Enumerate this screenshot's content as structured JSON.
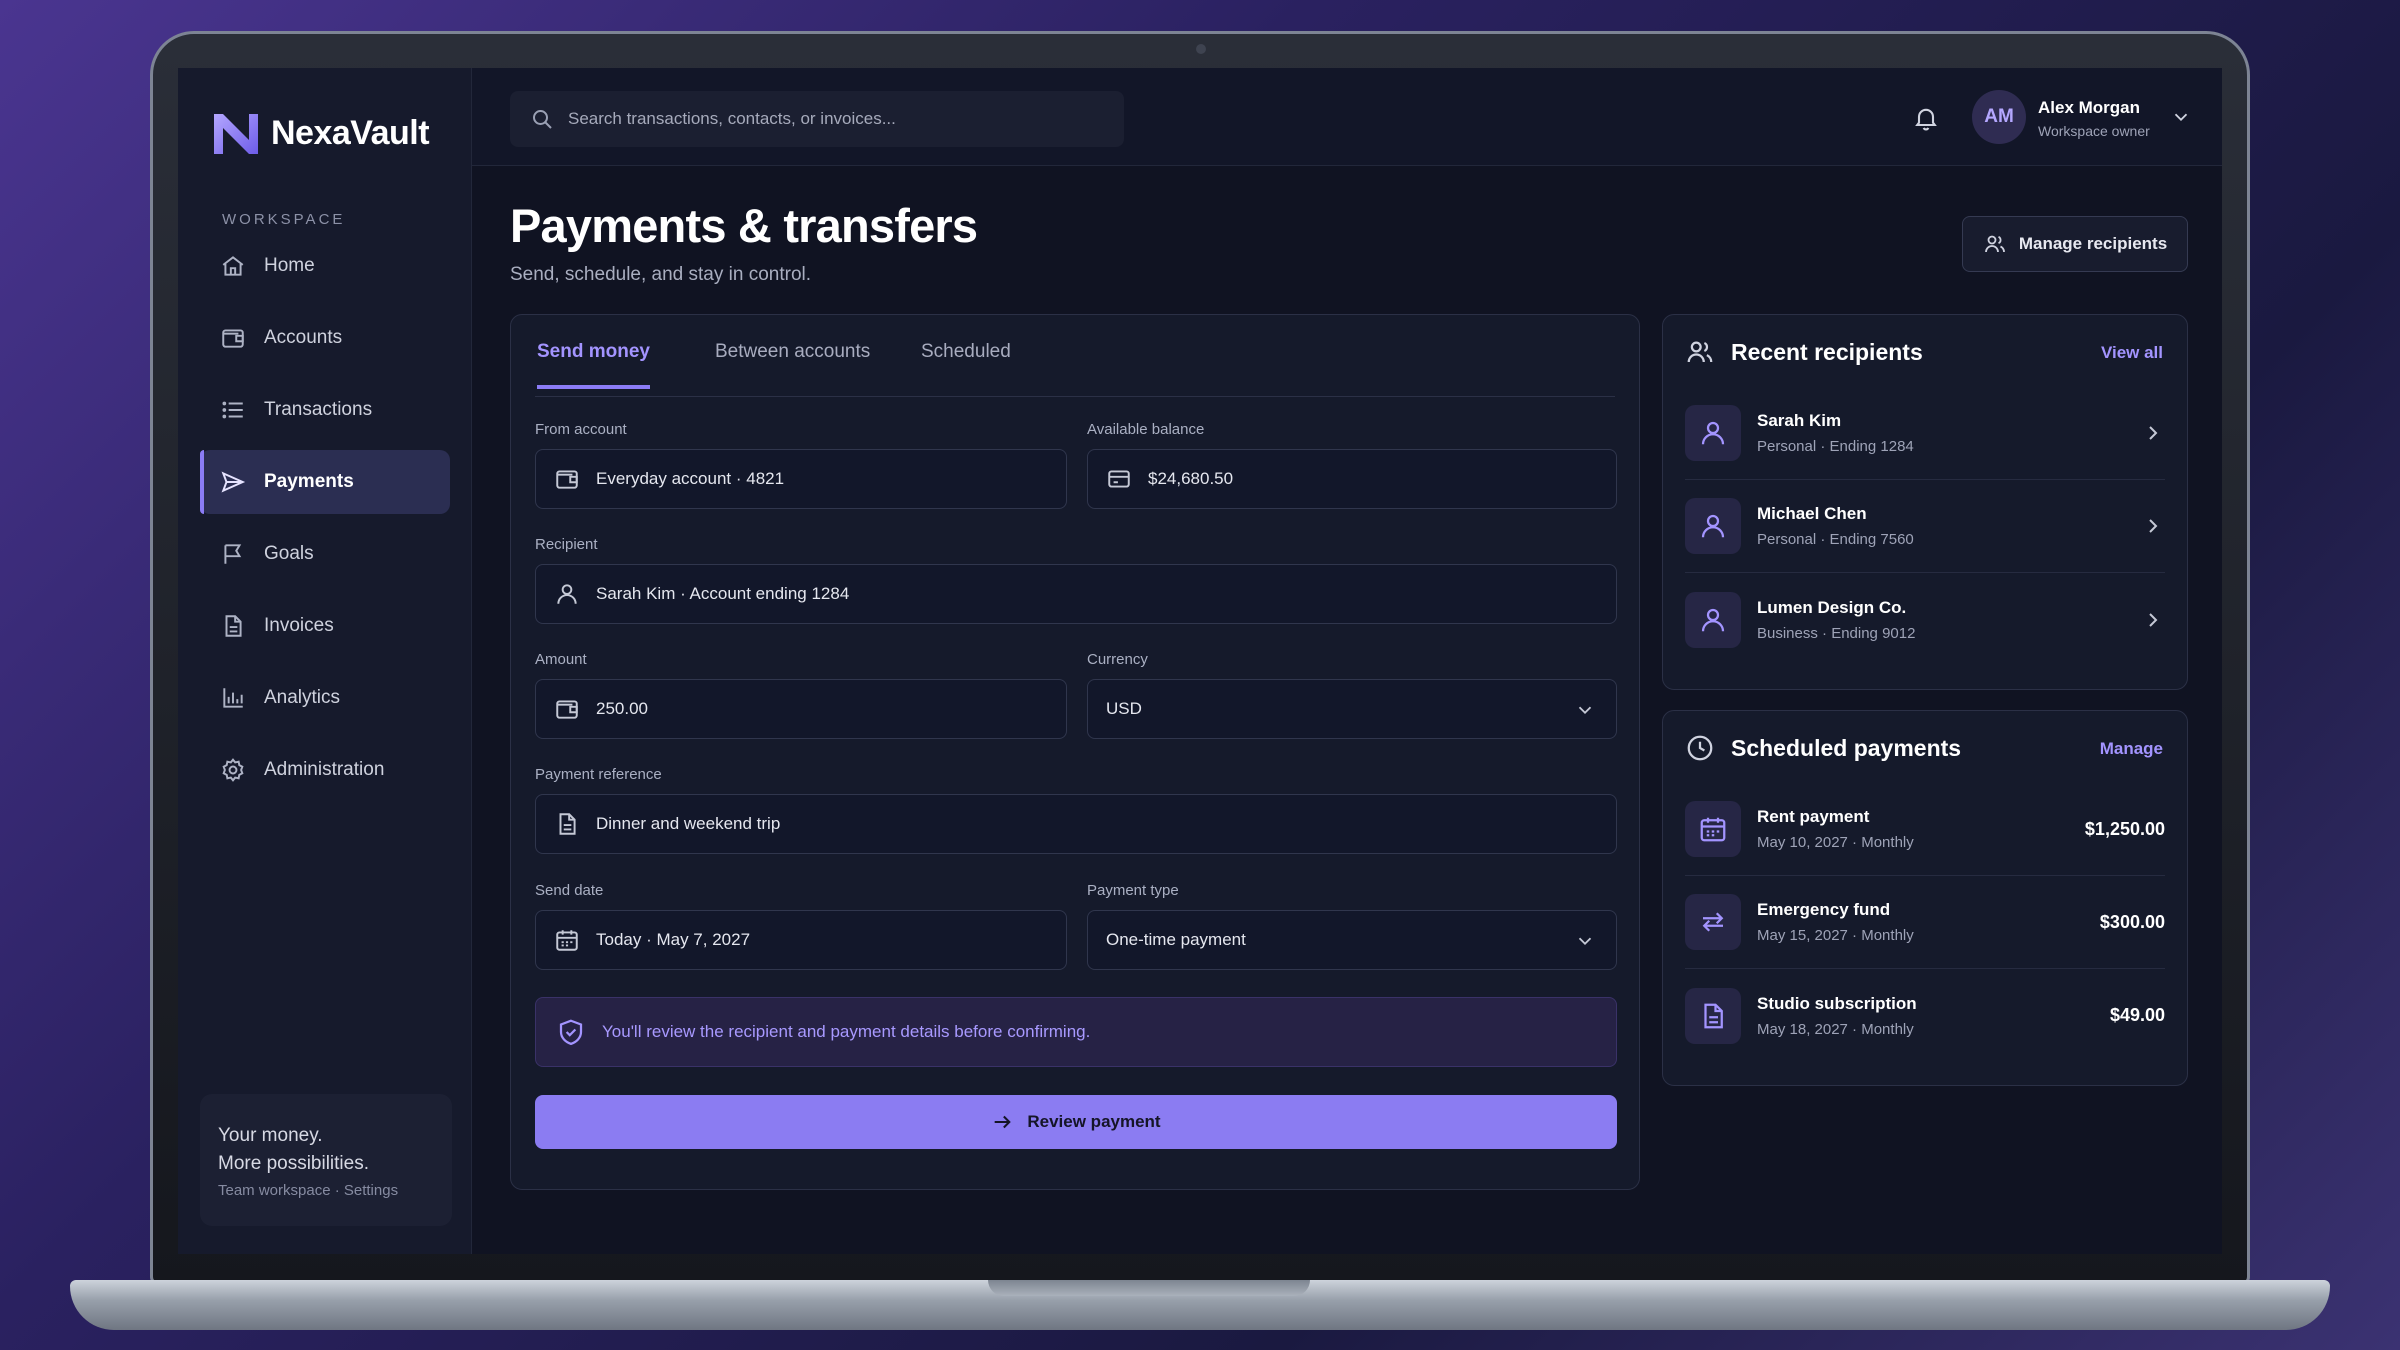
{
  "brand": {
    "name": "NexaVault"
  },
  "sidebar": {
    "section_label": "WORKSPACE",
    "items": [
      {
        "label": "Home",
        "icon": "home-icon"
      },
      {
        "label": "Accounts",
        "icon": "wallet-icon"
      },
      {
        "label": "Transactions",
        "icon": "list-icon"
      },
      {
        "label": "Payments",
        "icon": "send-icon",
        "active": true
      },
      {
        "label": "Goals",
        "icon": "flag-icon"
      },
      {
        "label": "Invoices",
        "icon": "document-icon"
      },
      {
        "label": "Analytics",
        "icon": "bar-chart-icon"
      },
      {
        "label": "Administration",
        "icon": "gear-icon"
      }
    ],
    "promo": {
      "line1": "Your money.",
      "line2": "More possibilities.",
      "sub": "Team workspace · Settings"
    }
  },
  "topbar": {
    "search_placeholder": "Search transactions, contacts, or invoices...",
    "user": {
      "initials": "AM",
      "name": "Alex Morgan",
      "role": "Workspace owner"
    }
  },
  "page": {
    "title": "Payments & transfers",
    "subtitle": "Send, schedule, and stay in control.",
    "manage_recipients": "Manage recipients"
  },
  "form": {
    "tabs": [
      {
        "label": "Send money",
        "active": true
      },
      {
        "label": "Between accounts"
      },
      {
        "label": "Scheduled"
      }
    ],
    "from_account": {
      "label": "From account",
      "value": "Everyday account · 4821"
    },
    "available_balance": {
      "label": "Available balance",
      "value": "$24,680.50"
    },
    "recipient": {
      "label": "Recipient",
      "value": "Sarah Kim · Account ending 1284"
    },
    "amount": {
      "label": "Amount",
      "value": "250.00"
    },
    "currency": {
      "label": "Currency",
      "value": "USD"
    },
    "reference": {
      "label": "Payment reference",
      "value": "Dinner and weekend trip"
    },
    "send_date": {
      "label": "Send date",
      "value": "Today · May 7, 2027"
    },
    "payment_type": {
      "label": "Payment type",
      "value": "One-time payment"
    },
    "notice": "You'll review the recipient and payment details before confirming.",
    "review_button": "Review payment"
  },
  "recent_recipients": {
    "title": "Recent recipients",
    "link": "View all",
    "items": [
      {
        "name": "Sarah Kim",
        "sub": "Personal · Ending 1284"
      },
      {
        "name": "Michael Chen",
        "sub": "Personal · Ending 7560"
      },
      {
        "name": "Lumen Design Co.",
        "sub": "Business · Ending 9012"
      }
    ]
  },
  "scheduled_payments": {
    "title": "Scheduled payments",
    "link": "Manage",
    "items": [
      {
        "name": "Rent payment",
        "sub": "May 10, 2027 · Monthly",
        "amount": "$1,250.00",
        "icon": "calendar-icon"
      },
      {
        "name": "Emergency fund",
        "sub": "May 15, 2027 · Monthly",
        "amount": "$300.00",
        "icon": "repeat-icon"
      },
      {
        "name": "Studio subscription",
        "sub": "May 18, 2027 · Monthly",
        "amount": "$49.00",
        "icon": "document-icon"
      }
    ]
  },
  "colors": {
    "accent": "#8b7cf6",
    "background": "#101322",
    "sidebar": "#161a2c"
  }
}
